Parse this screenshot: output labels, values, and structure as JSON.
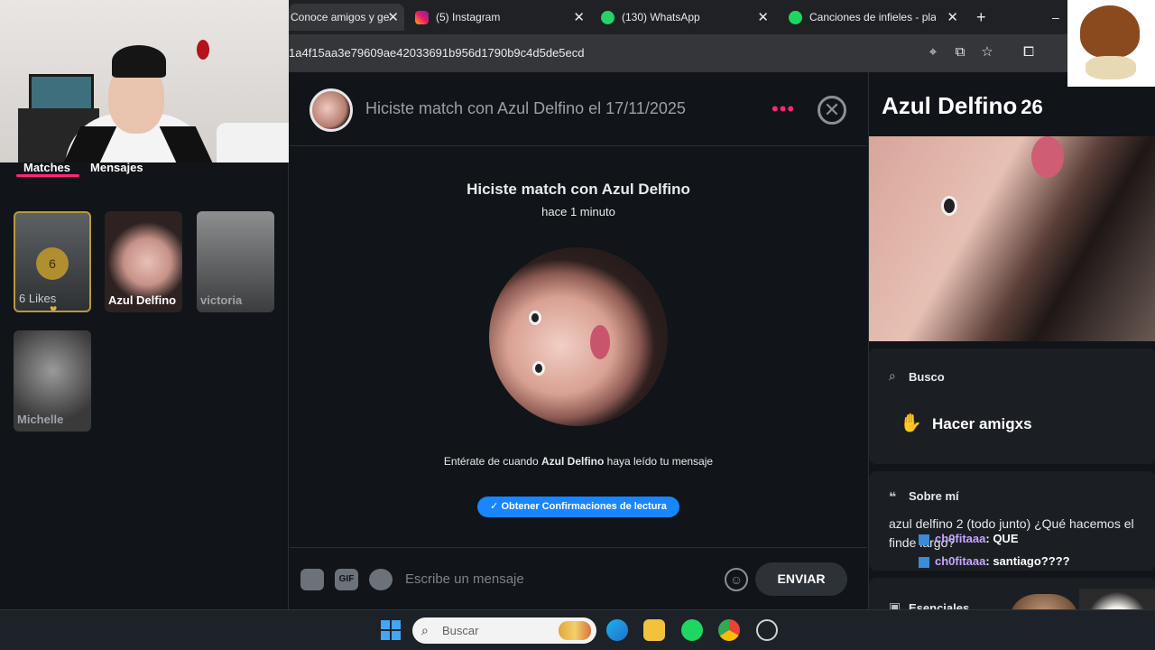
{
  "browser": {
    "tabs": [
      {
        "title": "Conoce amigos y ge",
        "icon": "tinder-icon",
        "active": true
      },
      {
        "title": "(5) Instagram",
        "icon": "instagram-icon",
        "active": false
      },
      {
        "title": "(130) WhatsApp",
        "icon": "whatsapp-icon",
        "active": false
      },
      {
        "title": "Canciones de infieles - playli",
        "icon": "spotify-icon",
        "active": false
      }
    ],
    "new_tab": "+",
    "minimize": "–",
    "close": "✕",
    "url": "1a4f15aa3e79609ae42033691b956d1790b9c4d5de5ecd"
  },
  "left": {
    "tabs": [
      "Matches",
      "Mensajes"
    ],
    "likes_count": "6",
    "likes_label": "6 Likes",
    "matches": [
      {
        "name": "Azul Delfino"
      },
      {
        "name": "victoria"
      },
      {
        "name": "Michelle"
      }
    ]
  },
  "chat": {
    "header_title": "Hiciste match con Azul Delfino el 17/11/2025",
    "dots": "•••",
    "close": "✕",
    "match_prefix": "Hiciste match con ",
    "match_name": "Azul Delfino",
    "match_time": "hace 1 minuto",
    "notice_pre": "Entérate de cuando ",
    "notice_name": "Azul Delfino",
    "notice_post": " haya leído tu mensaje",
    "read_button": "✓ Obtener Confirmaciones de lectura",
    "gif_label": "GIF",
    "input_placeholder": "Escribe un mensaje",
    "send": "ENVIAR"
  },
  "profile": {
    "name": "Azul Delfino",
    "age": "26",
    "busco_label": "Busco",
    "busco_value": "Hacer amigxs",
    "about_label": "Sobre mí",
    "about_text": "azul delfino 2 (todo junto) ¿Qué hacemos el finde largo?",
    "essentials_label": "Esenciales"
  },
  "stream_chat": [
    {
      "user": "ch0fitaaa",
      "text": ": QUE"
    },
    {
      "user": "ch0fitaaa",
      "text": ": santiago????"
    }
  ],
  "taskbar": {
    "search_placeholder": "Buscar"
  },
  "colors": {
    "accent": "#fd267a",
    "blue": "#1786ff",
    "bg": "#111418"
  }
}
